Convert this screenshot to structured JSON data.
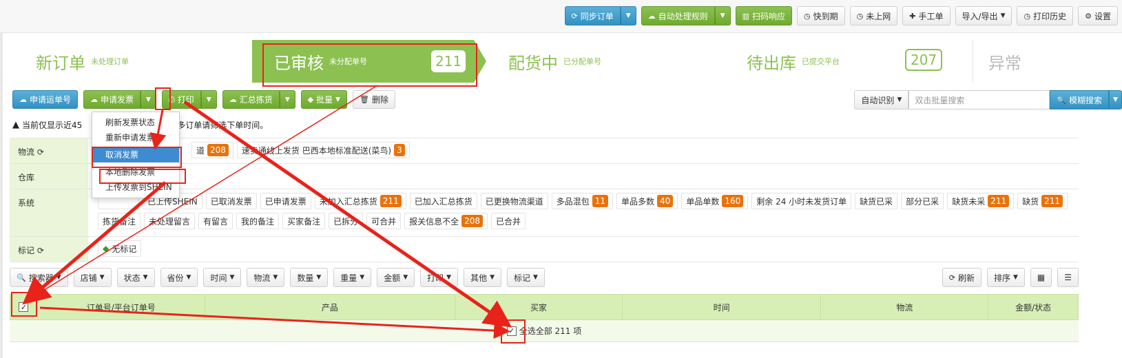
{
  "topbar": {
    "sync_order": "同步订单",
    "auto_rules": "自动处理规则",
    "scan": "扫码响应",
    "expiring": "快到期",
    "offline": "未上网",
    "manual_order": "手工单",
    "import_export": "导入/导出",
    "print_history": "打印历史",
    "settings": "设置"
  },
  "steps": [
    {
      "title": "新订单",
      "sub": "未处理订单",
      "count": ""
    },
    {
      "title": "已审核",
      "sub": "未分配单号",
      "count": "211"
    },
    {
      "title": "配货中",
      "sub": "已分配单号",
      "count": ""
    },
    {
      "title": "待出库",
      "sub": "已提交平台",
      "count": "207"
    },
    {
      "title": "异常",
      "sub": "",
      "count": ""
    }
  ],
  "actions": {
    "apply_waybill": "申请运单号",
    "apply_invoice": "申请发票",
    "print": "打印",
    "summary_pick": "汇总拣货",
    "batch": "批量",
    "delete": "删除"
  },
  "search": {
    "auto_detect": "自动识别",
    "placeholder": "双击批量搜索",
    "fuzzy_search": "模糊搜索"
  },
  "notice": {
    "prefix": "当前仅显示近45",
    "suffix": "多订单请筛选下单时间。"
  },
  "dropdown": {
    "items": [
      "刷新发票状态",
      "重新申请发票",
      "取消发票",
      "本地删除发票",
      "上传发票到SHEIN"
    ]
  },
  "filters": {
    "logistics": {
      "label": "物流",
      "tags": [
        {
          "text": "道",
          "count": "208"
        },
        {
          "text": "速卖通线上发货 巴西本地标准配送(菜鸟)",
          "count": "3"
        }
      ]
    },
    "warehouse": {
      "label": "仓库"
    },
    "system": {
      "label": "系统",
      "tags": [
        {
          "text": "",
          "count": ""
        },
        {
          "text": "已上传SHEIN",
          "count": ""
        },
        {
          "text": "已取消发票",
          "count": ""
        },
        {
          "text": "已申请发票",
          "count": ""
        },
        {
          "text": "未加入汇总拣货",
          "count": "211"
        },
        {
          "text": "已加入汇总拣货",
          "count": ""
        },
        {
          "text": "已更换物流渠道",
          "count": ""
        },
        {
          "text": "多品混包",
          "count": "11"
        },
        {
          "text": "单品多数",
          "count": "40"
        },
        {
          "text": "单品单数",
          "count": "160"
        },
        {
          "text": "剩余 24 小时未发货订单",
          "count": ""
        },
        {
          "text": "缺货已采",
          "count": ""
        },
        {
          "text": "部分已采",
          "count": ""
        },
        {
          "text": "缺货未采",
          "count": "211"
        },
        {
          "text": "缺货",
          "count": "211"
        },
        {
          "text": "拣货备注",
          "count": ""
        },
        {
          "text": "未处理留言",
          "count": ""
        },
        {
          "text": "有留言",
          "count": ""
        },
        {
          "text": "我的备注",
          "count": ""
        },
        {
          "text": "买家备注",
          "count": ""
        },
        {
          "text": "已拆分",
          "count": ""
        },
        {
          "text": "可合并",
          "count": ""
        },
        {
          "text": "报关信息不全",
          "count": "208"
        },
        {
          "text": "已合并",
          "count": ""
        }
      ]
    },
    "mark": {
      "label": "标记",
      "tags": [
        {
          "text": "无标记",
          "count": ""
        }
      ]
    }
  },
  "colfilters": [
    "搜索器",
    "店铺",
    "状态",
    "省份",
    "时间",
    "物流",
    "数量",
    "重量",
    "金额",
    "打印",
    "其他",
    "标记"
  ],
  "refresh": "刷新",
  "sort": "排序",
  "table": {
    "columns": [
      "订单号/平台订单号",
      "产品",
      "买家",
      "时间",
      "物流",
      "金额/状态"
    ],
    "select_all": "全选全部 211 项"
  },
  "colors": {
    "green": "#8cc152",
    "blue": "#3291c2",
    "badge": "#e8730c",
    "annotation": "#e8231a"
  }
}
